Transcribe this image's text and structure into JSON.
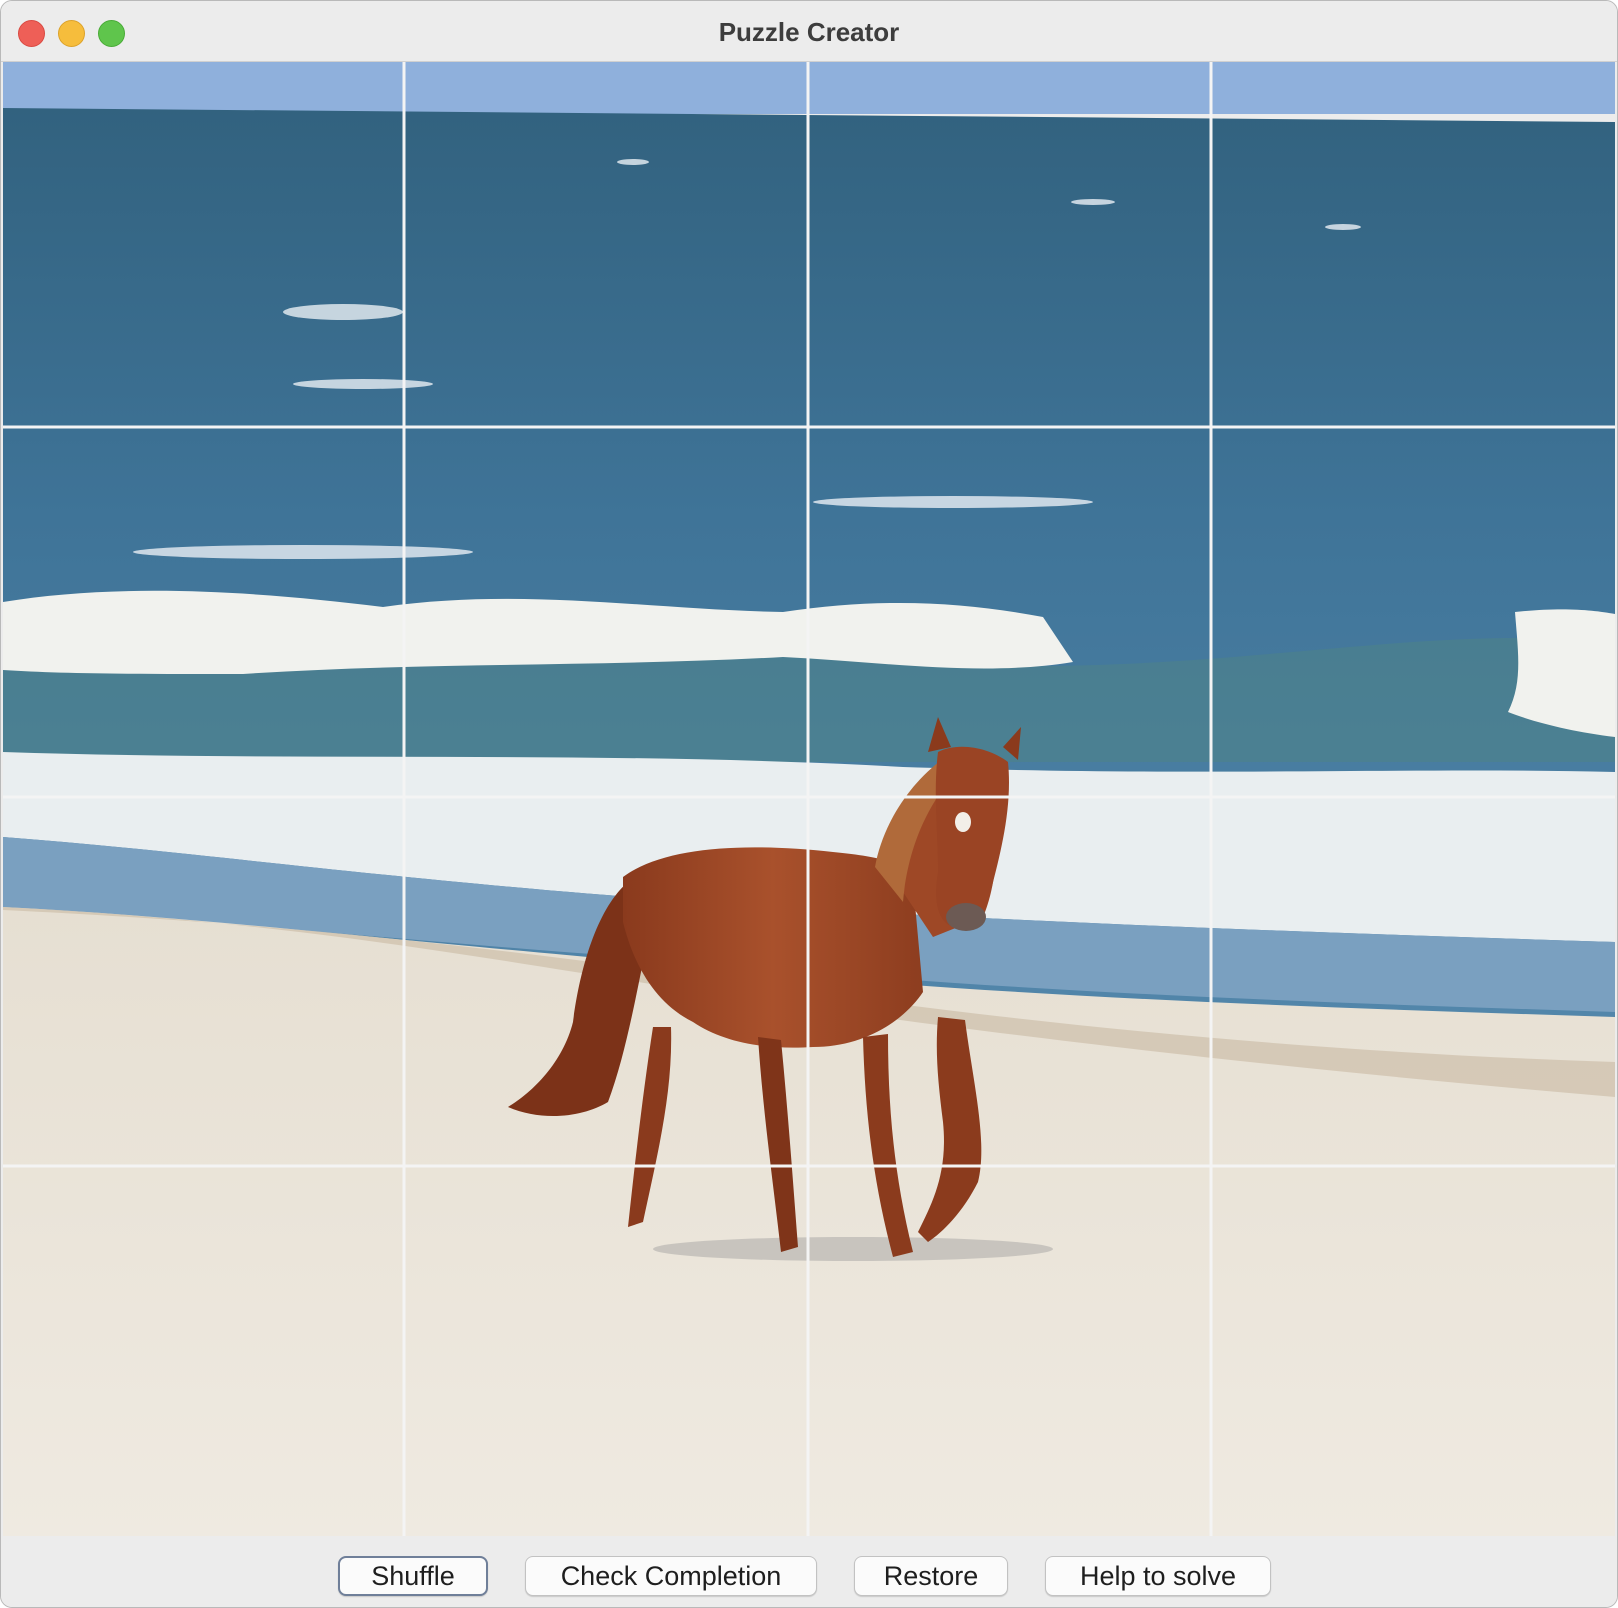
{
  "window": {
    "title": "Puzzle Creator"
  },
  "puzzle": {
    "rows": 4,
    "cols": 4,
    "image": "horse walking on beach with ocean waves"
  },
  "buttons": {
    "shuffle": "Shuffle",
    "check_completion": "Check Completion",
    "restore": "Restore",
    "help_to_solve": "Help to solve"
  },
  "colors": {
    "sky": "#8fb0dc",
    "sea": "#3f7296",
    "surf": "#f3f4f1",
    "sand": "#e9e3d7",
    "horse": "#9a4525",
    "grid_line": "#f4f4f4"
  }
}
